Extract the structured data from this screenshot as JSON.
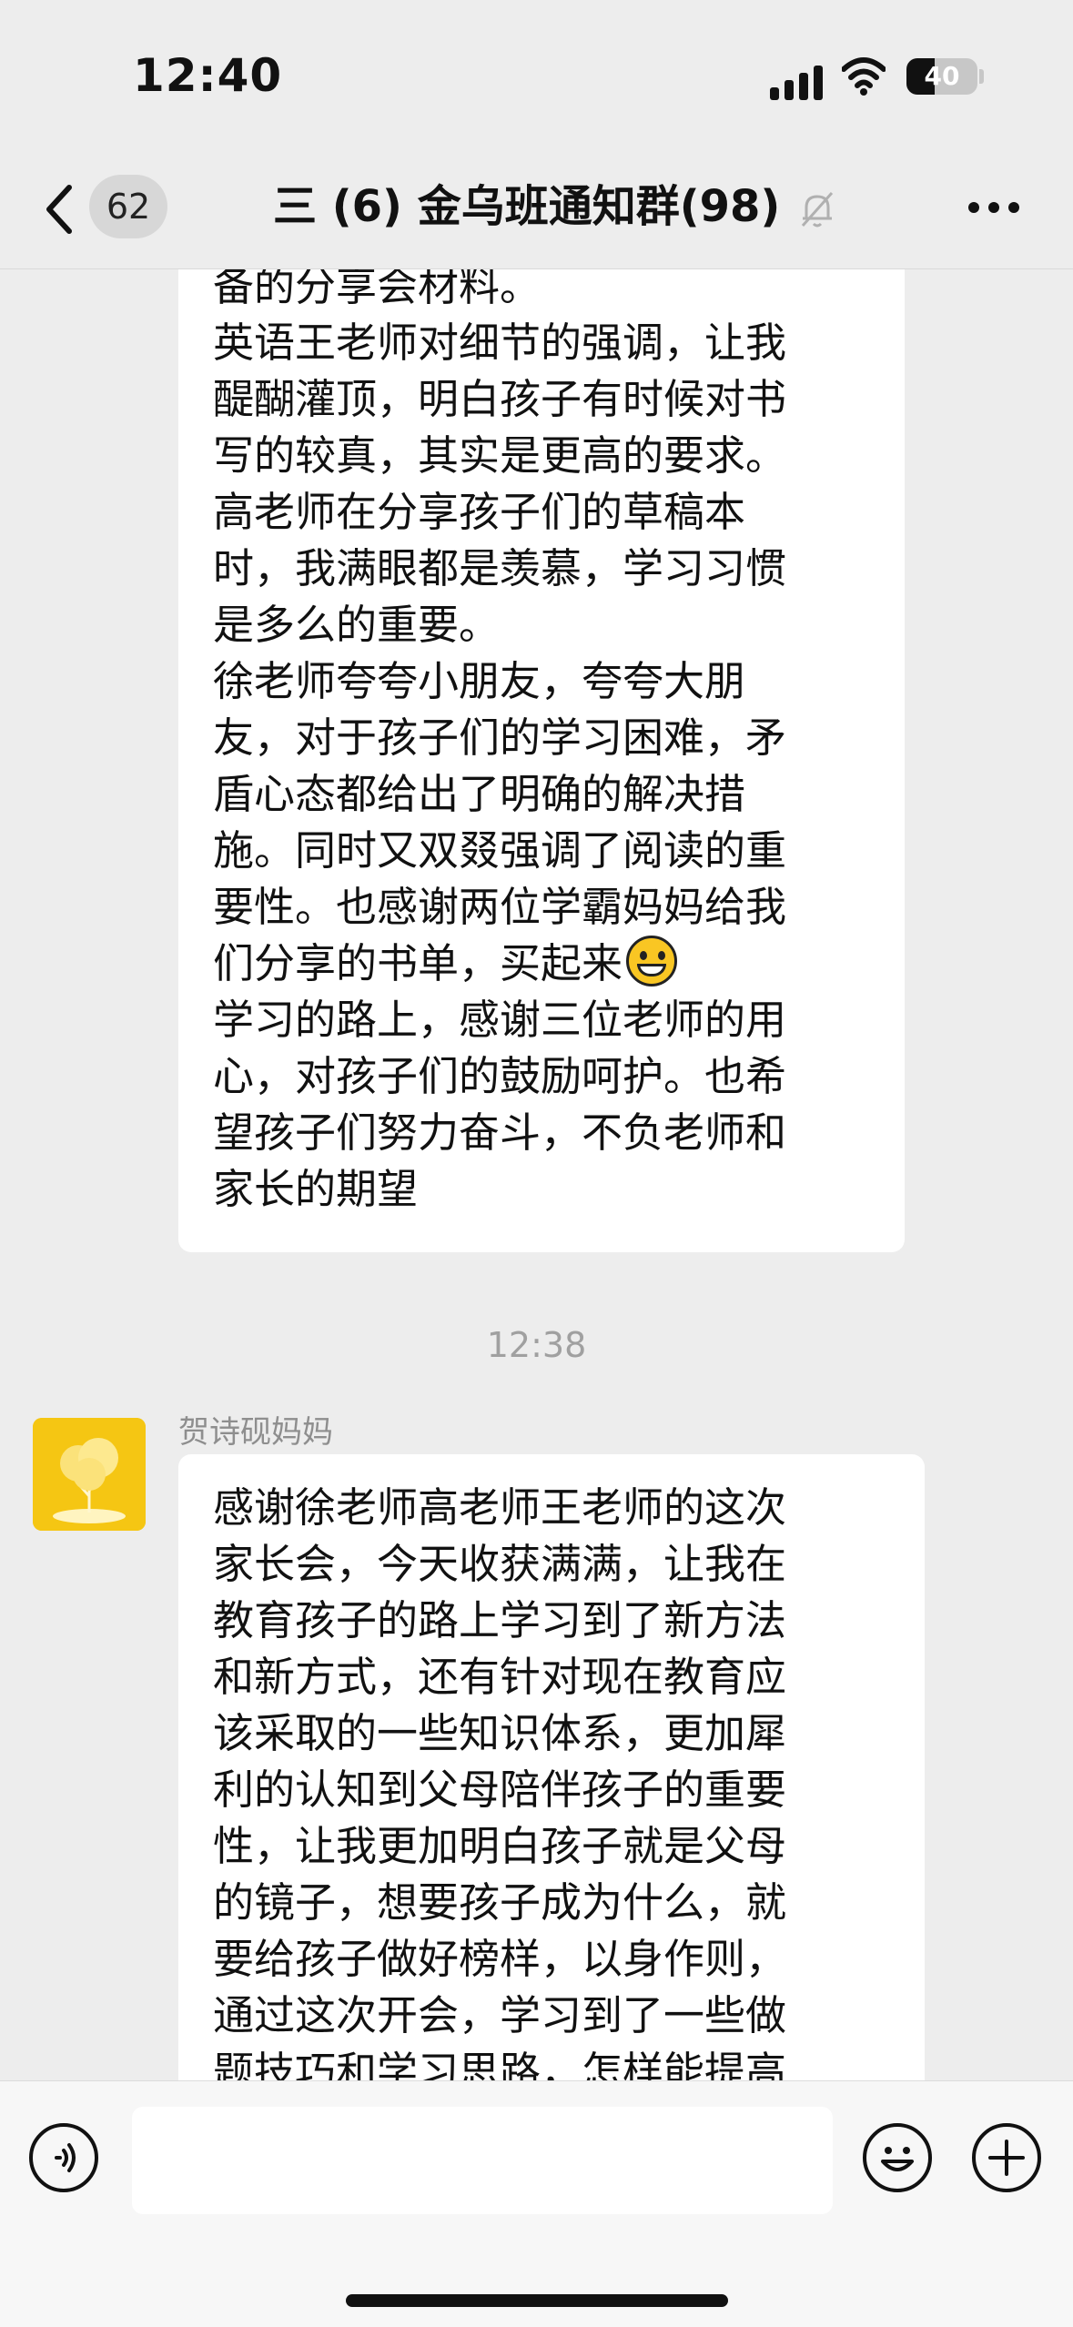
{
  "status_bar": {
    "time": "12:40",
    "battery": "40",
    "battery_level": 0.4
  },
  "nav": {
    "unread_count": "62",
    "title": "三 (6) 金乌班通知群(98)",
    "icons": [
      "back-icon",
      "mute-bell-icon",
      "more-icon"
    ]
  },
  "messages": [
    {
      "lines": [
        "备的分享会材料。",
        "英语王老师对细节的强调，让我",
        "醍醐灌顶，明白孩子有时候对书",
        "写的较真，其实是更高的要求。",
        "高老师在分享孩子们的草稿本",
        "时，我满眼都是羡慕，学习习惯",
        "是多么的重要。",
        "徐老师夸夸小朋友，夸夸大朋",
        "友，对于孩子们的学习困难，矛",
        "盾心态都给出了明确的解决措",
        "施。同时又双叕强调了阅读的重",
        "要性。也感谢两位学霸妈妈给我",
        "们分享的书单，买起来",
        "学习的路上，感谢三位老师的用",
        "心，对孩子们的鼓励呵护。也希",
        "望孩子们努力奋斗，不负老师和",
        "家长的期望"
      ],
      "emoji": "grinning-face-emoji"
    },
    {
      "timestamp": "12:38"
    },
    {
      "sender": "贺诗砚妈妈",
      "lines": [
        "感谢徐老师高老师王老师的这次",
        "家长会，今天收获满满，让我在",
        "教育孩子的路上学习到了新方法",
        "和新方式，还有针对现在教育应",
        "该采取的一些知识体系，更加犀",
        "利的认知到父母陪伴孩子的重要",
        "性，让我更加明白孩子就是父母",
        "的镜子，想要孩子成为什么，就",
        "要给孩子做好榜样，以身作则，",
        "通过这次开会，学习到了一些做",
        "题技巧和学习思路，怎样能提高"
      ]
    }
  ],
  "input_bar": {
    "message_value": "",
    "icons": [
      "voice-icon",
      "emoji-icon",
      "plus-icon"
    ]
  },
  "colors": {
    "background": "#ededed",
    "bubble": "#ffffff",
    "avatar": "#f5c613",
    "input_bar": "#f7f7f7"
  }
}
